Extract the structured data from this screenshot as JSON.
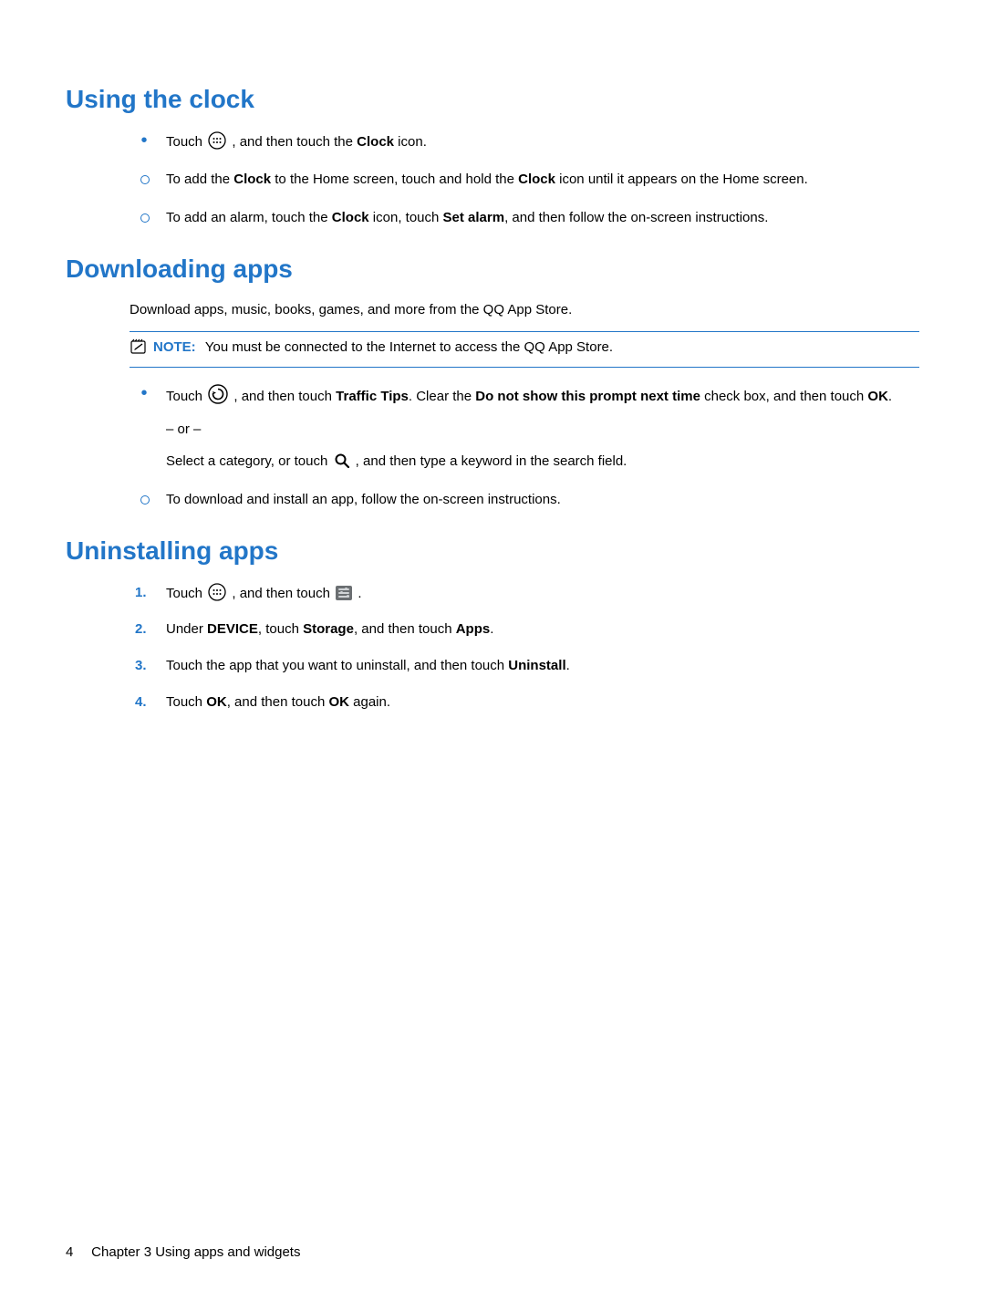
{
  "section1": {
    "heading": "Using the clock",
    "items": [
      {
        "type": "big-dot",
        "pre": "Touch ",
        "icon": "apps",
        "post_fragments": [
          {
            "t": ", and then touch the "
          },
          {
            "t": "Clock",
            "b": true
          },
          {
            "t": " icon."
          }
        ]
      },
      {
        "type": "small-dot",
        "fragments": [
          {
            "t": "To add the "
          },
          {
            "t": "Clock",
            "b": true
          },
          {
            "t": " to the Home screen, touch and hold the "
          },
          {
            "t": "Clock",
            "b": true
          },
          {
            "t": " icon until it appears on the Home screen."
          }
        ]
      },
      {
        "type": "small-dot",
        "fragments": [
          {
            "t": "To add an alarm, touch the "
          },
          {
            "t": "Clock",
            "b": true
          },
          {
            "t": " icon, touch "
          },
          {
            "t": "Set alarm",
            "b": true
          },
          {
            "t": ", and then follow the on-screen instructions."
          }
        ]
      }
    ]
  },
  "section2": {
    "heading": "Downloading apps",
    "intro": "Download apps, music, books, games, and more from the QQ App Store.",
    "note_label": "NOTE:",
    "note_text": "You must be connected to the Internet to access the QQ App Store.",
    "big_item": {
      "pre": "Touch ",
      "icon": "refresh-circle",
      "mid_fragments": [
        {
          "t": ", and then touch "
        },
        {
          "t": "Traffic Tips",
          "b": true
        },
        {
          "t": ". Clear the "
        },
        {
          "t": "Do not show this prompt next time",
          "b": true
        },
        {
          "t": " check box, and then touch "
        },
        {
          "t": "OK",
          "b": true
        },
        {
          "t": "."
        }
      ],
      "or": "– or –",
      "search_pre": "Select a category, or touch",
      "search_icon": "search",
      "search_post": ", and then type a keyword in the search field."
    },
    "small_item": {
      "text": "To download and install an app, follow the on-screen instructions."
    }
  },
  "section3": {
    "heading": "Uninstalling apps",
    "steps": [
      {
        "n": "1.",
        "pre": "Touch ",
        "icon": "apps",
        "mid": ", and then touch ",
        "icon2": "settings-chip",
        "post": "."
      },
      {
        "n": "2.",
        "fragments": [
          {
            "t": "Under "
          },
          {
            "t": "DEVICE",
            "b": true
          },
          {
            "t": ", touch "
          },
          {
            "t": "Storage",
            "b": true
          },
          {
            "t": ", and then touch "
          },
          {
            "t": "Apps",
            "b": true
          },
          {
            "t": "."
          }
        ]
      },
      {
        "n": "3.",
        "fragments": [
          {
            "t": "Touch the app that you want to uninstall, and then touch "
          },
          {
            "t": "Uninstall",
            "b": true
          },
          {
            "t": "."
          }
        ]
      },
      {
        "n": "4.",
        "fragments": [
          {
            "t": "Touch "
          },
          {
            "t": "OK",
            "b": true
          },
          {
            "t": ", and then touch "
          },
          {
            "t": "OK",
            "b": true
          },
          {
            "t": " again."
          }
        ]
      }
    ]
  },
  "footer": {
    "page": "4",
    "chapter": "Chapter 3   Using apps and widgets"
  }
}
